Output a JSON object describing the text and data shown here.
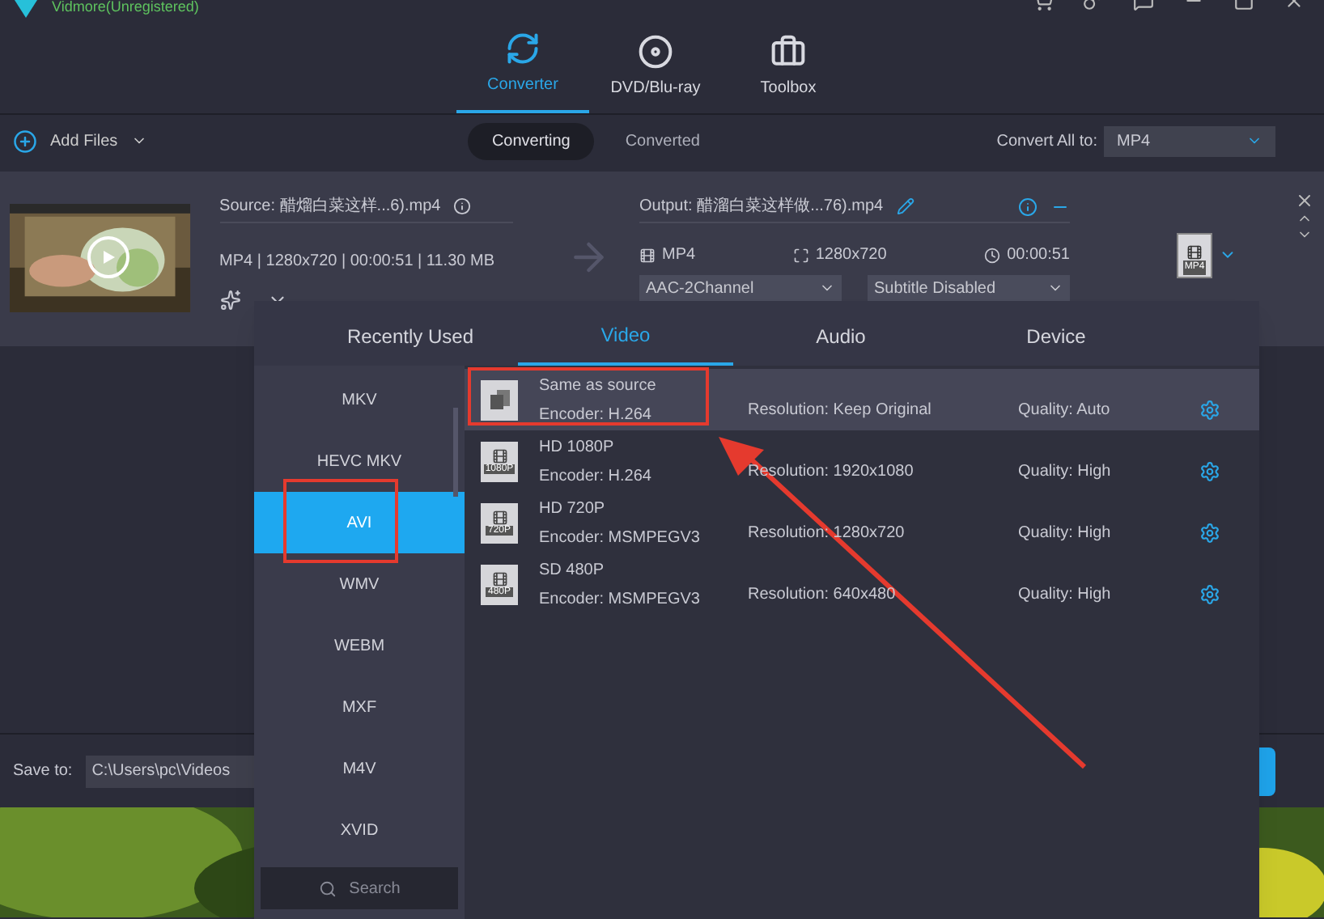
{
  "window": {
    "title": "Vidmore(Unregistered)"
  },
  "nav_tabs": [
    {
      "label": "Converter",
      "kind": "converter",
      "selected": true
    },
    {
      "label": "DVD/Blu-ray",
      "kind": "disc",
      "selected": false
    },
    {
      "label": "Toolbox",
      "kind": "toolbox",
      "selected": false
    }
  ],
  "toolbar": {
    "add_files": "Add Files",
    "segments": [
      {
        "label": "Converting",
        "selected": true
      },
      {
        "label": "Converted",
        "selected": false
      }
    ],
    "convert_all_label": "Convert All to:",
    "convert_all_value": "MP4"
  },
  "file": {
    "source": "Source: 醋熘白菜这样...6).mp4",
    "meta": "MP4 | 1280x720 | 00:00:51 | 11.30 MB",
    "output": "Output: 醋溜白菜这样做...76).mp4",
    "out_format": "MP4",
    "out_resolution": "1280x720",
    "out_duration": "00:00:51",
    "audio": "AAC-2Channel",
    "subtitle": "Subtitle Disabled",
    "format_badge": "MP4"
  },
  "save_to": {
    "label": "Save to:",
    "path": "C:\\Users\\pc\\Videos"
  },
  "format_popup": {
    "tabs": [
      {
        "label": "Recently Used",
        "selected": false
      },
      {
        "label": "Video",
        "selected": true
      },
      {
        "label": "Audio",
        "selected": false
      },
      {
        "label": "Device",
        "selected": false
      }
    ],
    "formats": [
      {
        "label": "MKV",
        "selected": false
      },
      {
        "label": "HEVC MKV",
        "selected": false
      },
      {
        "label": "AVI",
        "selected": true
      },
      {
        "label": "WMV",
        "selected": false
      },
      {
        "label": "WEBM",
        "selected": false
      },
      {
        "label": "MXF",
        "selected": false
      },
      {
        "label": "M4V",
        "selected": false
      },
      {
        "label": "XVID",
        "selected": false
      }
    ],
    "search_placeholder": "Search",
    "presets": [
      {
        "kind": "source",
        "name": "Same as source",
        "encoder": "Encoder: H.264",
        "resolution": "Resolution: Keep Original",
        "quality": "Quality: Auto",
        "selected": true
      },
      {
        "kind": "film",
        "name": "HD 1080P",
        "badge": "1080P",
        "encoder": "Encoder: H.264",
        "resolution": "Resolution: 1920x1080",
        "quality": "Quality: High",
        "selected": false
      },
      {
        "kind": "film",
        "name": "HD 720P",
        "badge": "720P",
        "encoder": "Encoder: MSMPEGV3",
        "resolution": "Resolution: 1280x720",
        "quality": "Quality: High",
        "selected": false
      },
      {
        "kind": "film",
        "name": "SD 480P",
        "badge": "480P",
        "encoder": "Encoder: MSMPEGV3",
        "resolution": "Resolution: 640x480",
        "quality": "Quality: High",
        "selected": false
      }
    ]
  }
}
